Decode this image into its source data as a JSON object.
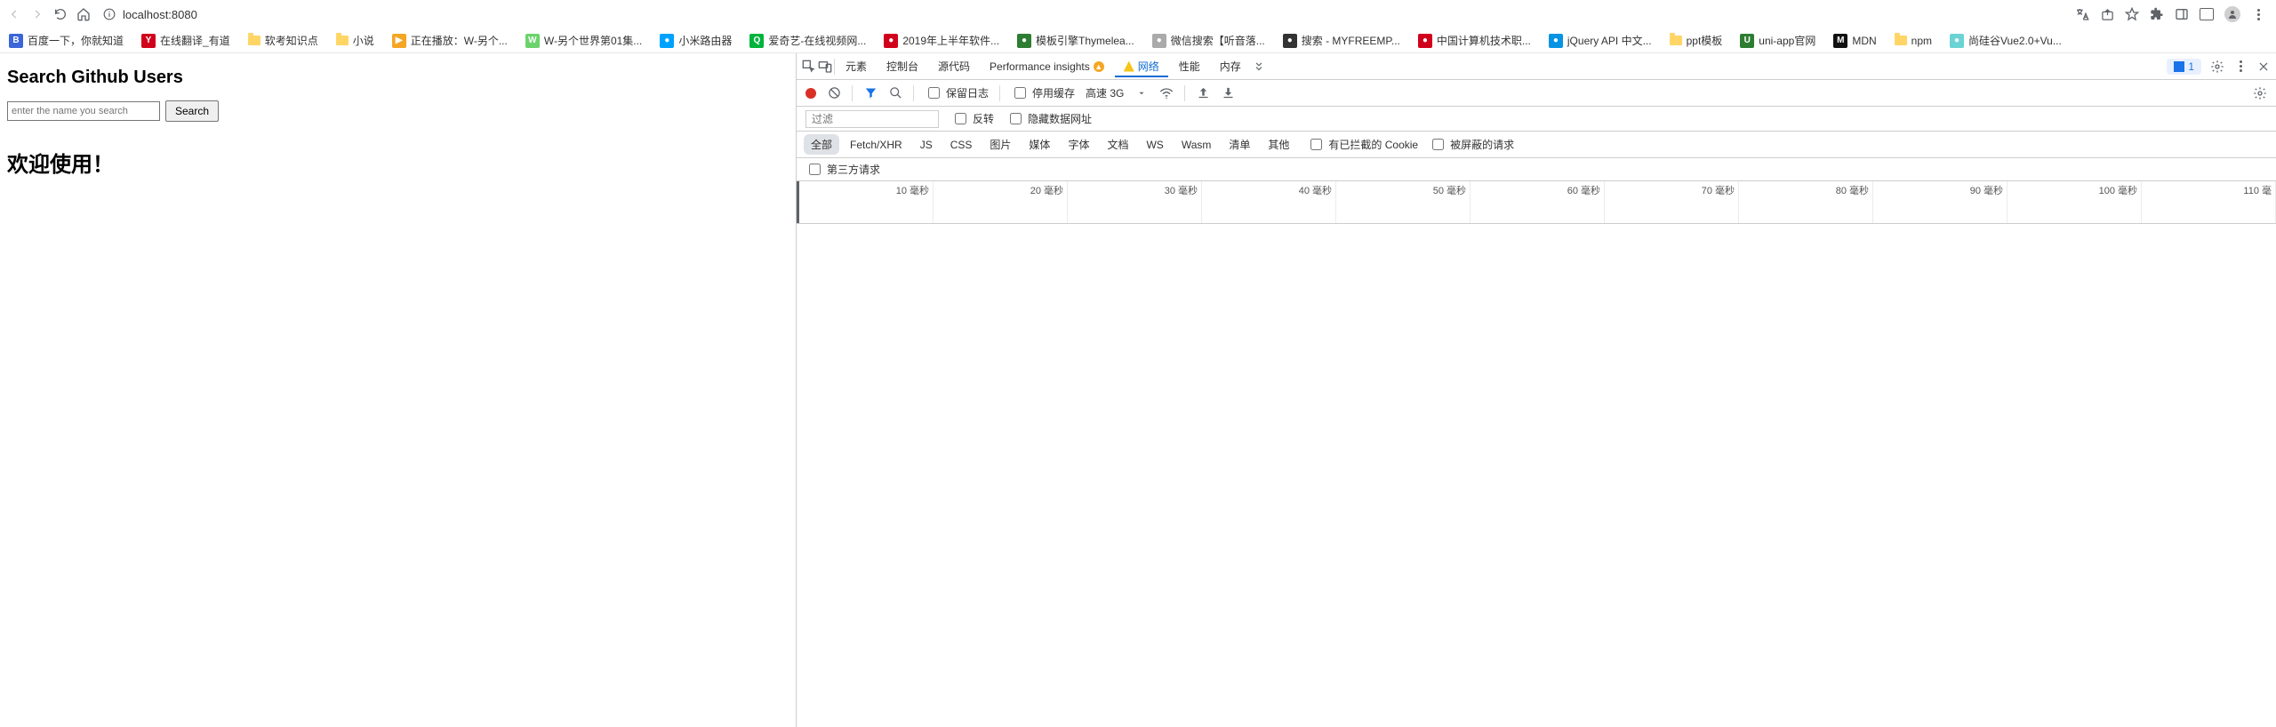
{
  "browser": {
    "url": "localhost:8080"
  },
  "bookmarks": [
    {
      "label": "百度一下，你就知道",
      "color": "#3b65d9",
      "glyph": "B"
    },
    {
      "label": "在线翻译_有道",
      "color": "#d0021b",
      "glyph": "Y"
    },
    {
      "label": "软考知识点",
      "folder": true
    },
    {
      "label": "小说",
      "folder": true
    },
    {
      "label": "正在播放：W-另个...",
      "color": "#f5a623",
      "glyph": "▶"
    },
    {
      "label": "W-另个世界第01集...",
      "color": "#6bd36b",
      "glyph": "W"
    },
    {
      "label": "小米路由器",
      "color": "#00a2ff",
      "glyph": "●"
    },
    {
      "label": "爱奇艺-在线视频网...",
      "color": "#00b33c",
      "glyph": "Q"
    },
    {
      "label": "2019年上半年软件...",
      "color": "#d0021b",
      "glyph": "●"
    },
    {
      "label": "模板引擎Thymelea...",
      "color": "#2e7d32",
      "glyph": "●"
    },
    {
      "label": "微信搜索【听音落...",
      "color": "#aaa",
      "glyph": "●"
    },
    {
      "label": "搜索 - MYFREEMP...",
      "color": "#333",
      "glyph": "●"
    },
    {
      "label": "中国计算机技术职...",
      "color": "#d0021b",
      "glyph": "●"
    },
    {
      "label": "jQuery API 中文...",
      "color": "#0693e3",
      "glyph": "●"
    },
    {
      "label": "ppt模板",
      "folder": true
    },
    {
      "label": "uni-app官网",
      "color": "#2e7d32",
      "glyph": "U"
    },
    {
      "label": "MDN",
      "color": "#111",
      "glyph": "M"
    },
    {
      "label": "npm",
      "folder": true
    },
    {
      "label": "尚硅谷Vue2.0+Vu...",
      "color": "#6bd3d3",
      "glyph": "●"
    }
  ],
  "page": {
    "heading": "Search Github Users",
    "placeholder": "enter the name you search",
    "button": "Search",
    "welcome": "欢迎使用！"
  },
  "devtools": {
    "tabs": {
      "elements": "元素",
      "console": "控制台",
      "sources": "源代码",
      "perfinsights": "Performance insights",
      "network": "网络",
      "performance": "性能",
      "memory": "内存"
    },
    "issues_count": "1",
    "toolbar": {
      "preserve": "保留日志",
      "disable_cache": "停用缓存",
      "throttle": "高速 3G"
    },
    "filter": {
      "placeholder": "过滤",
      "invert": "反转",
      "hide_data": "隐藏数据网址"
    },
    "types": [
      "全部",
      "Fetch/XHR",
      "JS",
      "CSS",
      "图片",
      "媒体",
      "字体",
      "文档",
      "WS",
      "Wasm",
      "清单",
      "其他"
    ],
    "blocked_cookie": "有已拦截的 Cookie",
    "blocked_req": "被屏蔽的请求",
    "third_party": "第三方请求",
    "timeline": [
      "10 毫秒",
      "20 毫秒",
      "30 毫秒",
      "40 毫秒",
      "50 毫秒",
      "60 毫秒",
      "70 毫秒",
      "80 毫秒",
      "90 毫秒",
      "100 毫秒",
      "110 毫"
    ]
  }
}
